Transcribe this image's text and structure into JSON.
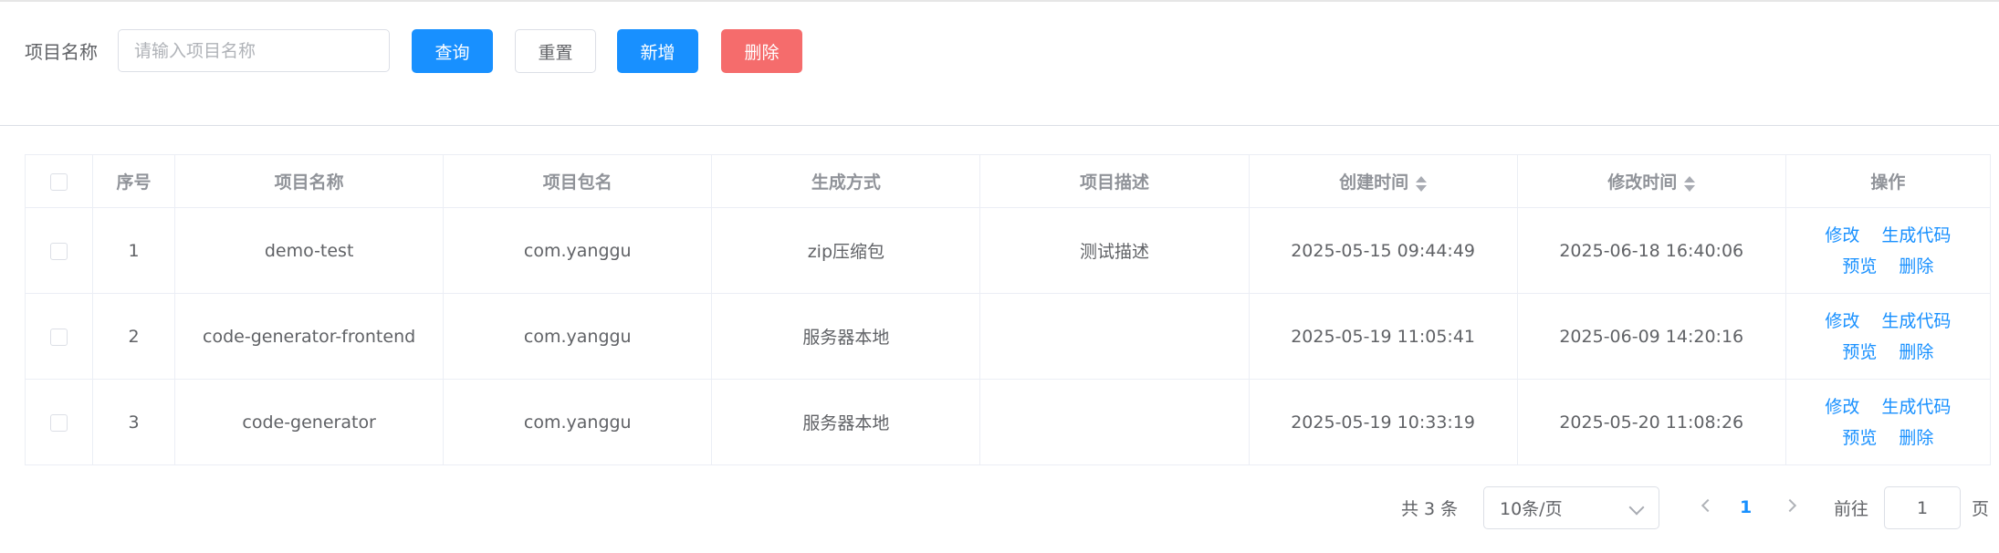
{
  "search": {
    "label": "项目名称",
    "placeholder": "请输入项目名称",
    "query_label": "查询",
    "reset_label": "重置",
    "add_label": "新增",
    "delete_label": "删除"
  },
  "table": {
    "columns": [
      "序号",
      "项目名称",
      "项目包名",
      "生成方式",
      "项目描述",
      "创建时间",
      "修改时间",
      "操作"
    ],
    "rows": [
      {
        "index": "1",
        "name": "demo-test",
        "package": "com.yanggu",
        "mode": "zip压缩包",
        "desc": "测试描述",
        "created": "2025-05-15 09:44:49",
        "modified": "2025-06-18 16:40:06"
      },
      {
        "index": "2",
        "name": "code-generator-frontend",
        "package": "com.yanggu",
        "mode": "服务器本地",
        "desc": "",
        "created": "2025-05-19 11:05:41",
        "modified": "2025-06-09 14:20:16"
      },
      {
        "index": "3",
        "name": "code-generator",
        "package": "com.yanggu",
        "mode": "服务器本地",
        "desc": "",
        "created": "2025-05-19 10:33:19",
        "modified": "2025-05-20 11:08:26"
      }
    ],
    "actions": {
      "edit": "修改",
      "generate": "生成代码",
      "preview": "预览",
      "delete": "删除"
    }
  },
  "pagination": {
    "total": "共 3 条",
    "page_size": "10条/页",
    "current_page": "1",
    "goto_label": "前往",
    "goto_value": "1",
    "page_unit": "页"
  },
  "colors": {
    "primary": "#1890ff",
    "danger": "#f56c6c",
    "border": "#ebeef5"
  }
}
